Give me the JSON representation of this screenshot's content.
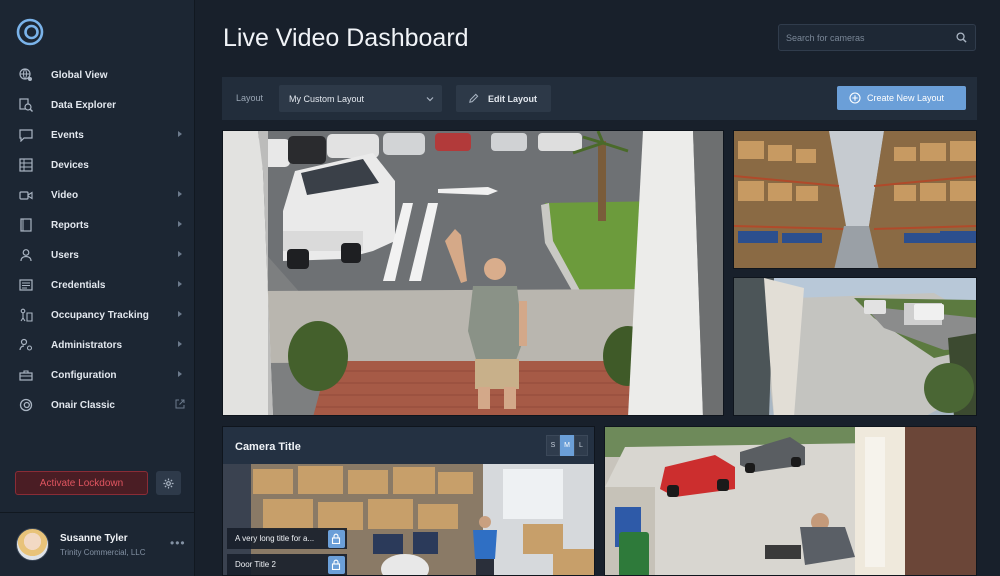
{
  "sidebar": {
    "logo_icon": "onair-logo-icon",
    "items": [
      {
        "label": "Global View",
        "icon": "globe-icon",
        "has_submenu": false
      },
      {
        "label": "Data Explorer",
        "icon": "data-search-icon",
        "has_submenu": false
      },
      {
        "label": "Events",
        "icon": "chat-icon",
        "has_submenu": true
      },
      {
        "label": "Devices",
        "icon": "list-icon",
        "has_submenu": false
      },
      {
        "label": "Video",
        "icon": "video-icon",
        "has_submenu": true
      },
      {
        "label": "Reports",
        "icon": "report-icon",
        "has_submenu": true
      },
      {
        "label": "Users",
        "icon": "user-icon",
        "has_submenu": true
      },
      {
        "label": "Credentials",
        "icon": "id-card-icon",
        "has_submenu": true
      },
      {
        "label": "Occupancy Tracking",
        "icon": "occupancy-icon",
        "has_submenu": true
      },
      {
        "label": "Administrators",
        "icon": "admin-icon",
        "has_submenu": true
      },
      {
        "label": "Configuration",
        "icon": "toolbox-icon",
        "has_submenu": true
      },
      {
        "label": "Onair Classic",
        "icon": "onair-classic-icon",
        "has_submenu": false,
        "external": true
      }
    ],
    "lockdown_label": "Activate Lockdown",
    "user": {
      "name": "Susanne Tyler",
      "org": "Trinity Commercial, LLC"
    }
  },
  "header": {
    "title": "Live Video Dashboard",
    "search_placeholder": "Search for cameras"
  },
  "toolbar": {
    "layout_label": "Layout",
    "layout_value": "My Custom Layout",
    "edit_label": "Edit Layout",
    "create_label": "Create New Layout"
  },
  "cameras": {
    "featured_title": "Camera Title",
    "sizes": [
      "S",
      "M",
      "L"
    ],
    "active_size": "M",
    "doors": [
      {
        "label": "A very long title for a..."
      },
      {
        "label": "Door Title 2"
      }
    ]
  },
  "colors": {
    "accent": "#6b9fd8",
    "danger": "#e05560",
    "background": "#18202b"
  }
}
